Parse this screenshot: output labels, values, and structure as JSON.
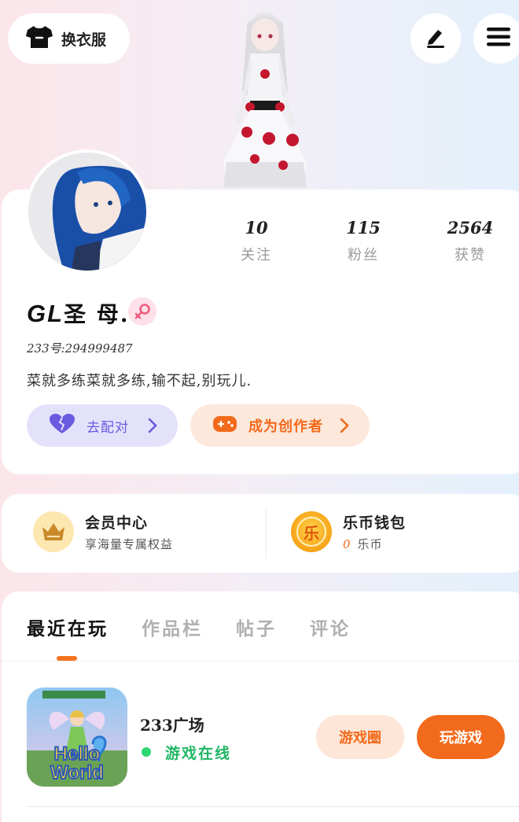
{
  "header": {
    "outfit_label": "换衣服",
    "icons": {
      "outfit": "tshirt-icon",
      "edit": "pencil-icon",
      "menu": "hamburger-menu-icon"
    }
  },
  "profile": {
    "stats": [
      {
        "value": "10",
        "label": "关注"
      },
      {
        "value": "115",
        "label": "粉丝"
      },
      {
        "value": "2564",
        "label": "获赞"
      }
    ],
    "nickname_latin": "GL",
    "nickname_cjk": "圣 母.",
    "gender_icon": "female-icon",
    "uid": "233号:294999487",
    "bio": "菜就多练菜就多练,输不起,别玩儿.",
    "actions": {
      "match_label": "去配对",
      "creator_label": "成为创作者"
    }
  },
  "wallet": {
    "member": {
      "title": "会员中心",
      "subtitle": "享海量专属权益"
    },
    "coins": {
      "title": "乐币钱包",
      "amount": "0",
      "unit": "乐币",
      "icon_char": "乐"
    }
  },
  "tabs": {
    "items": [
      "最近在玩",
      "作品栏",
      "帖子",
      "评论"
    ],
    "active": 0
  },
  "recent_game": {
    "name": "233广场",
    "status": "游戏在线",
    "icon_text_line1": "Hello",
    "icon_text_line2": "World",
    "circle_button": "游戏圈",
    "play_button": "玩游戏"
  },
  "colors": {
    "accent": "#f26a1b",
    "online": "#1fb764",
    "match": "#6a5ae0"
  }
}
